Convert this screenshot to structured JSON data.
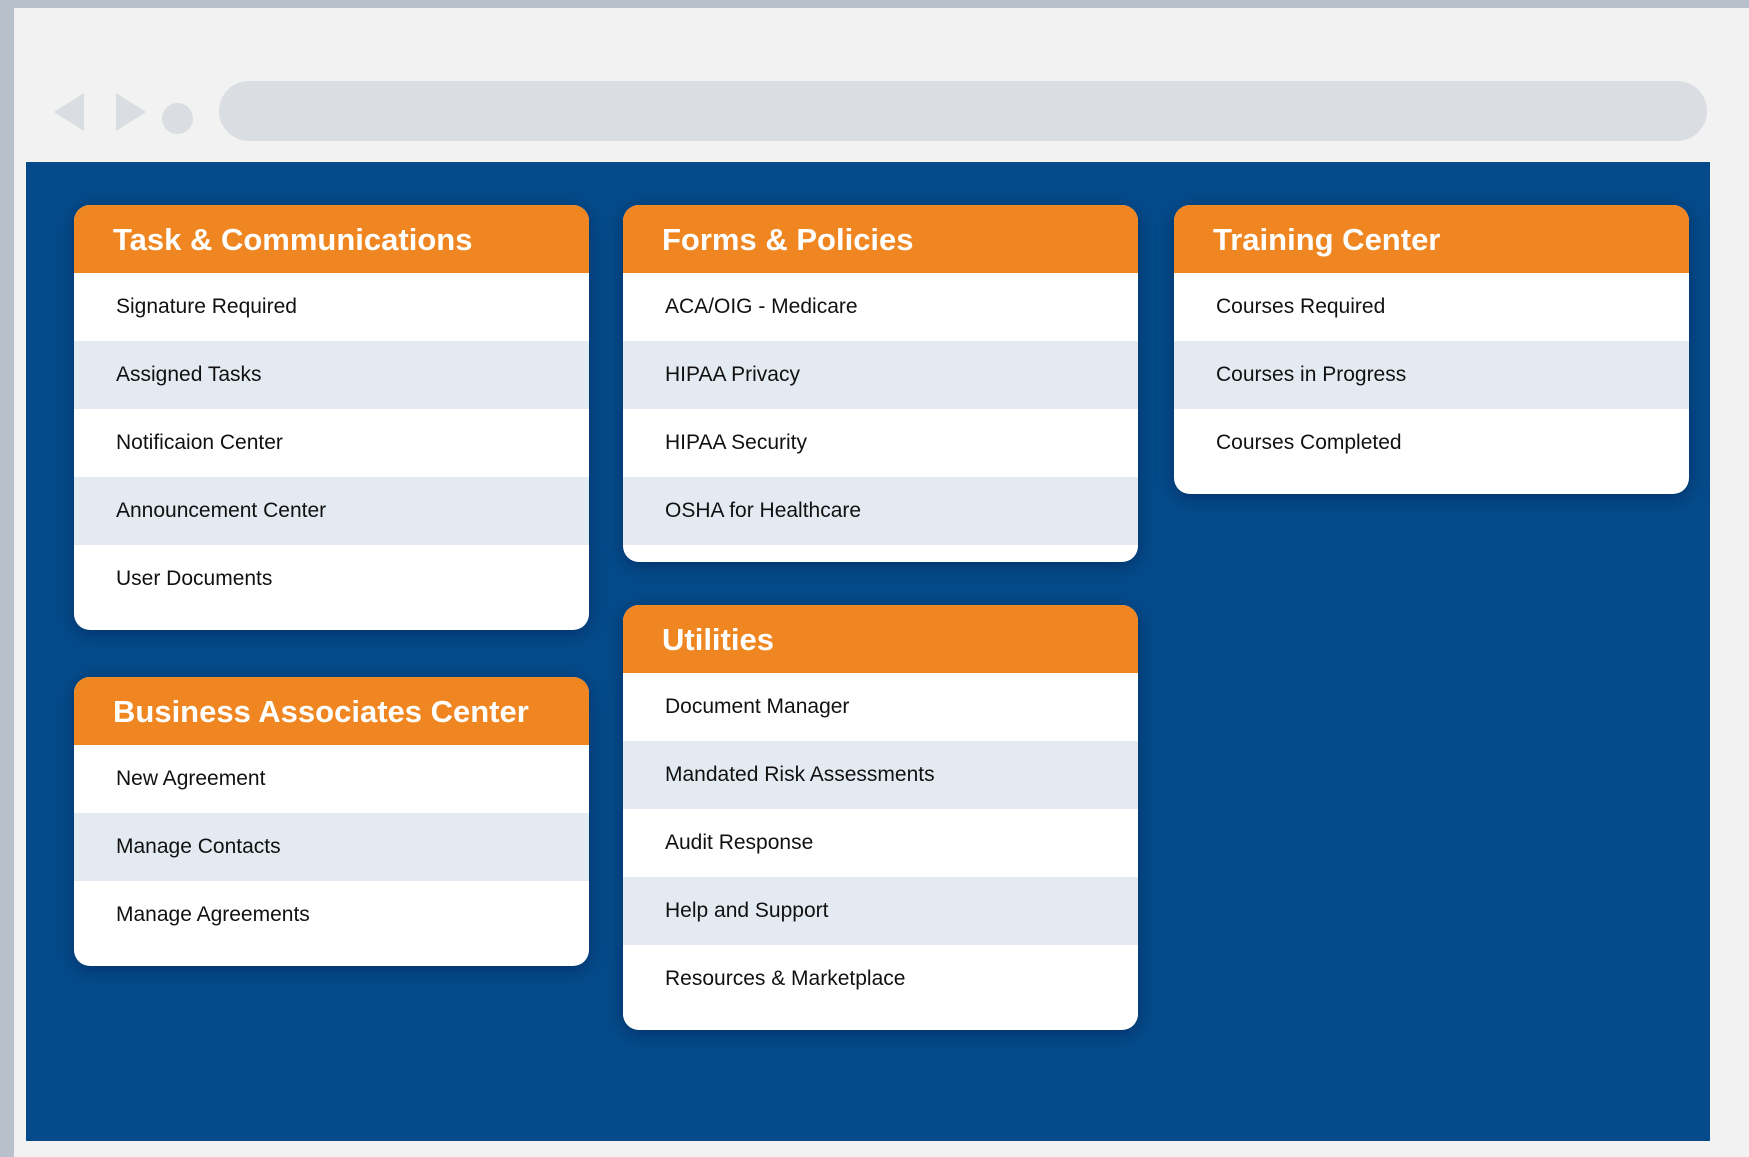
{
  "cards": {
    "tasks": {
      "title": "Task & Communications",
      "items": [
        "Signature Required",
        "Assigned Tasks",
        "Notificaion Center",
        "Announcement Center",
        "User Documents"
      ]
    },
    "business": {
      "title": "Business Associates Center",
      "items": [
        "New Agreement",
        "Manage Contacts",
        "Manage Agreements"
      ]
    },
    "forms": {
      "title": "Forms & Policies",
      "items": [
        "ACA/OIG - Medicare",
        "HIPAA Privacy",
        "HIPAA Security",
        "OSHA for Healthcare"
      ]
    },
    "utilities": {
      "title": "Utilities",
      "items": [
        "Document Manager",
        "Mandated Risk Assessments",
        "Audit Response",
        "Help and Support",
        "Resources & Marketplace"
      ]
    },
    "training": {
      "title": "Training Center",
      "items": [
        "Courses Required",
        "Courses in Progress",
        "Courses Completed"
      ]
    }
  },
  "colors": {
    "background": "#054b8b",
    "header": "#f08622",
    "row_alt": "#e4eaf2"
  },
  "icons": {
    "back": "back-arrow-icon",
    "forward": "forward-arrow-icon",
    "reload": "reload-dot-icon"
  }
}
